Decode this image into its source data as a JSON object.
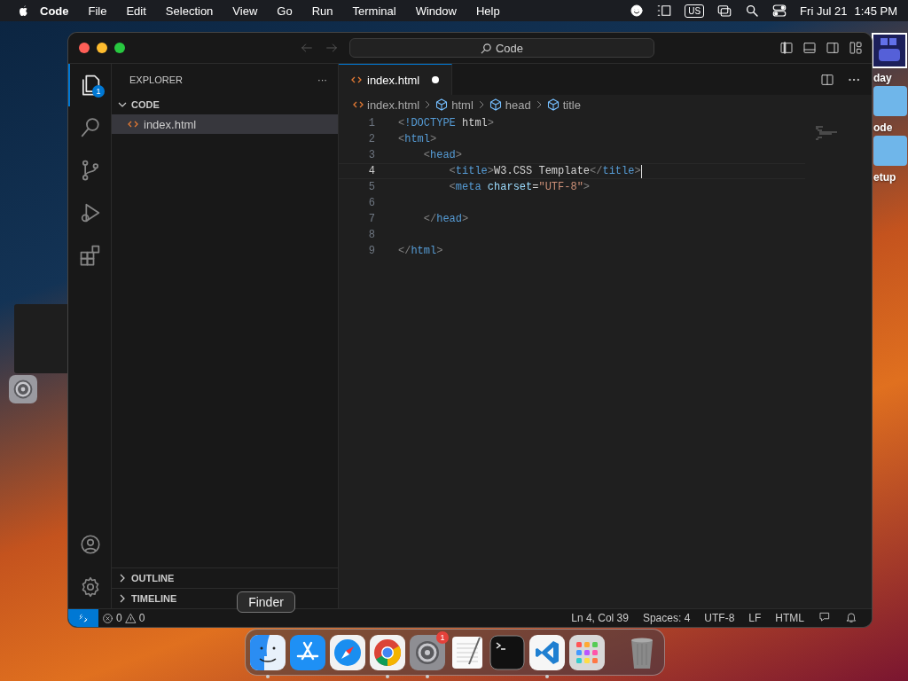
{
  "menu_bar": {
    "app_name": "Code",
    "menus": [
      "File",
      "Edit",
      "Selection",
      "View",
      "Go",
      "Run",
      "Terminal",
      "Window",
      "Help"
    ],
    "input_source": "US",
    "date": "Fri Jul 21",
    "time": "1:45 PM"
  },
  "desktop_icons": [
    {
      "label": "day",
      "kind": "app"
    },
    {
      "label": "ode",
      "kind": "folder"
    },
    {
      "label": "etup",
      "kind": "folder"
    }
  ],
  "window": {
    "command_center": "Code",
    "activity_bar": [
      {
        "kind": "explorer",
        "selected": true,
        "badge": "1"
      },
      {
        "kind": "search",
        "selected": false
      },
      {
        "kind": "source-control",
        "selected": false
      },
      {
        "kind": "run-debug",
        "selected": false
      },
      {
        "kind": "extensions",
        "selected": false
      }
    ],
    "activity_bar_bottom": [
      {
        "kind": "account"
      },
      {
        "kind": "settings"
      }
    ],
    "sidebar": {
      "title": "EXPLORER",
      "more": "···",
      "folder": {
        "name": "CODE",
        "expanded": true,
        "files": [
          {
            "name": "index.html",
            "selected": true
          }
        ]
      },
      "sections": [
        {
          "name": "OUTLINE",
          "expanded": false
        },
        {
          "name": "TIMELINE",
          "expanded": false
        }
      ]
    },
    "tabs": [
      {
        "label": "index.html",
        "selected": true,
        "modified": true
      }
    ],
    "breadcrumbs": [
      {
        "label": "index.html",
        "kind": "file"
      },
      {
        "label": "html",
        "kind": "element"
      },
      {
        "label": "head",
        "kind": "element"
      },
      {
        "label": "title",
        "kind": "element"
      }
    ],
    "lines": [
      {
        "number": "1",
        "current": false,
        "tokens": [
          {
            "text": "<",
            "kind": "punct"
          },
          {
            "text": "!DOCTYPE",
            "kind": "tag"
          },
          {
            "text": " html",
            "kind": "plain"
          },
          {
            "text": ">",
            "kind": "punct"
          }
        ]
      },
      {
        "number": "2",
        "current": false,
        "tokens": [
          {
            "text": "<",
            "kind": "punct"
          },
          {
            "text": "html",
            "kind": "tag"
          },
          {
            "text": ">",
            "kind": "punct"
          }
        ],
        "children": [
          {
            "number": "3",
            "current": false,
            "tokens": [
              {
                "text": "<",
                "kind": "punct"
              },
              {
                "text": "head",
                "kind": "tag"
              },
              {
                "text": ">",
                "kind": "punct"
              }
            ],
            "children": [
              {
                "number": "4",
                "current": true,
                "tokens": [
                  {
                    "text": "<",
                    "kind": "punct"
                  },
                  {
                    "text": "title",
                    "kind": "tag"
                  },
                  {
                    "text": ">",
                    "kind": "punct"
                  },
                  {
                    "text": "W3.CSS Template",
                    "kind": "plain"
                  },
                  {
                    "text": "</",
                    "kind": "punct"
                  },
                  {
                    "text": "title",
                    "kind": "tag"
                  },
                  {
                    "text": ">",
                    "kind": "punct"
                  }
                ]
              },
              {
                "number": "5",
                "current": false,
                "tokens": [
                  {
                    "text": "<",
                    "kind": "punct"
                  },
                  {
                    "text": "meta",
                    "kind": "tag"
                  },
                  {
                    "text": " charset",
                    "kind": "attr"
                  },
                  {
                    "text": "=",
                    "kind": "plain"
                  },
                  {
                    "text": "\"UTF-8\"",
                    "kind": "string"
                  },
                  {
                    "text": ">",
                    "kind": "punct"
                  }
                ]
              },
              {
                "number": "6",
                "current": false
              }
            ]
          },
          {
            "number": "7",
            "current": false,
            "tokens": [
              {
                "text": "</",
                "kind": "punct"
              },
              {
                "text": "head",
                "kind": "tag"
              },
              {
                "text": ">",
                "kind": "punct"
              }
            ]
          },
          {
            "number": "8",
            "current": false
          }
        ]
      },
      {
        "number": "9",
        "current": false,
        "tokens": [
          {
            "text": "</",
            "kind": "punct"
          },
          {
            "text": "html",
            "kind": "tag"
          },
          {
            "text": ">",
            "kind": "punct"
          }
        ]
      }
    ],
    "status_bar": {
      "errors": "0",
      "warnings": "0",
      "items": [
        "Ln 4, Col 39",
        "Spaces: 4",
        "UTF-8",
        "LF",
        "HTML"
      ]
    }
  },
  "dock": {
    "tooltip": "Finder",
    "apps": [
      {
        "kind": "finder",
        "running": true
      },
      {
        "kind": "app-store",
        "running": false
      },
      {
        "kind": "safari",
        "running": false
      },
      {
        "kind": "chrome",
        "running": true
      },
      {
        "kind": "settings",
        "running": true,
        "badge": "1"
      },
      {
        "kind": "textedit",
        "running": false
      },
      {
        "kind": "terminal",
        "running": false
      },
      {
        "kind": "vscode",
        "running": true
      },
      {
        "kind": "launchpad",
        "running": false
      }
    ],
    "trash": {
      "kind": "trash"
    }
  }
}
